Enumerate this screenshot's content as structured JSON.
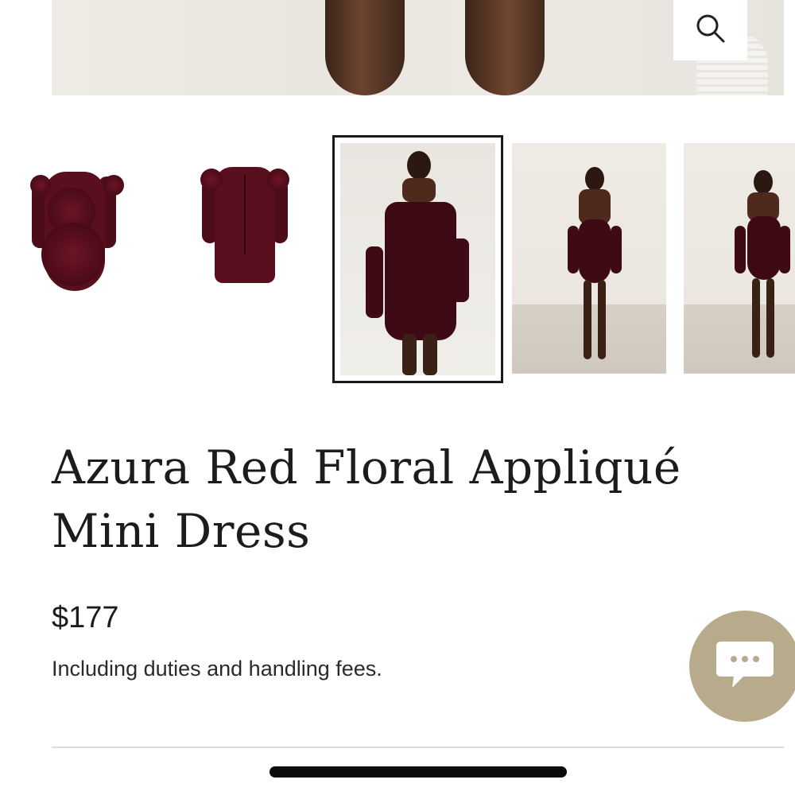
{
  "gallery": {
    "zoom_icon": "search-icon",
    "thumbnails": [
      {
        "label": "dress-front-flatlay",
        "selected": false
      },
      {
        "label": "dress-back-flatlay",
        "selected": false
      },
      {
        "label": "model-front",
        "selected": true
      },
      {
        "label": "model-back",
        "selected": false
      },
      {
        "label": "model-side",
        "selected": false
      }
    ]
  },
  "product": {
    "title": "Azura Red Floral Appliqué Mini Dress",
    "price": "$177",
    "tax_note": "Including duties and handling fees."
  },
  "chat": {
    "icon": "chat-bubble-icon",
    "color": "#b8ab8c"
  },
  "colors": {
    "dress": "#5a0f1e",
    "text": "#1c1c1c"
  }
}
